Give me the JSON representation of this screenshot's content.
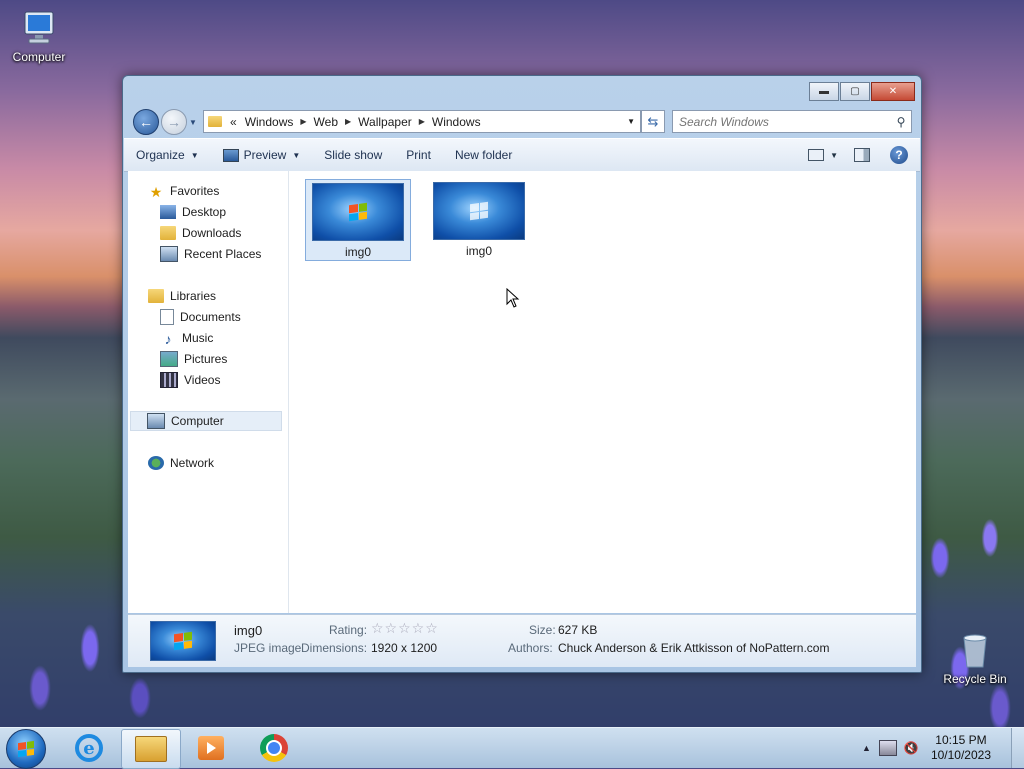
{
  "desktop": {
    "computer_label": "Computer",
    "recycle_label": "Recycle Bin"
  },
  "window": {
    "controls": {
      "minimize": "▬",
      "maximize": "▢",
      "close": "✕"
    },
    "address": {
      "overflow": "«",
      "crumbs": [
        "Windows",
        "Web",
        "Wallpaper",
        "Windows"
      ]
    },
    "search_placeholder": "Search Windows",
    "toolbar": {
      "organize": "Organize",
      "preview": "Preview",
      "slideshow": "Slide show",
      "print": "Print",
      "new_folder": "New folder",
      "help": "?"
    },
    "nav": {
      "favorites": "Favorites",
      "desktop": "Desktop",
      "downloads": "Downloads",
      "recent": "Recent Places",
      "libraries": "Libraries",
      "documents": "Documents",
      "music": "Music",
      "pictures": "Pictures",
      "videos": "Videos",
      "computer": "Computer",
      "network": "Network"
    },
    "files": [
      {
        "name": "img0",
        "selected": true
      },
      {
        "name": "img0",
        "selected": false
      }
    ],
    "details": {
      "name": "img0",
      "type": "JPEG image",
      "rating_label": "Rating:",
      "rating_stars": "☆☆☆☆☆",
      "dimensions_label": "Dimensions:",
      "dimensions": "1920 x 1200",
      "size_label": "Size:",
      "size": "627 KB",
      "authors_label": "Authors:",
      "authors": "Chuck Anderson & Erik Attkisson of NoPattern.com"
    }
  },
  "taskbar": {
    "time": "10:15 PM",
    "date": "10/10/2023",
    "ie_glyph": "e"
  }
}
